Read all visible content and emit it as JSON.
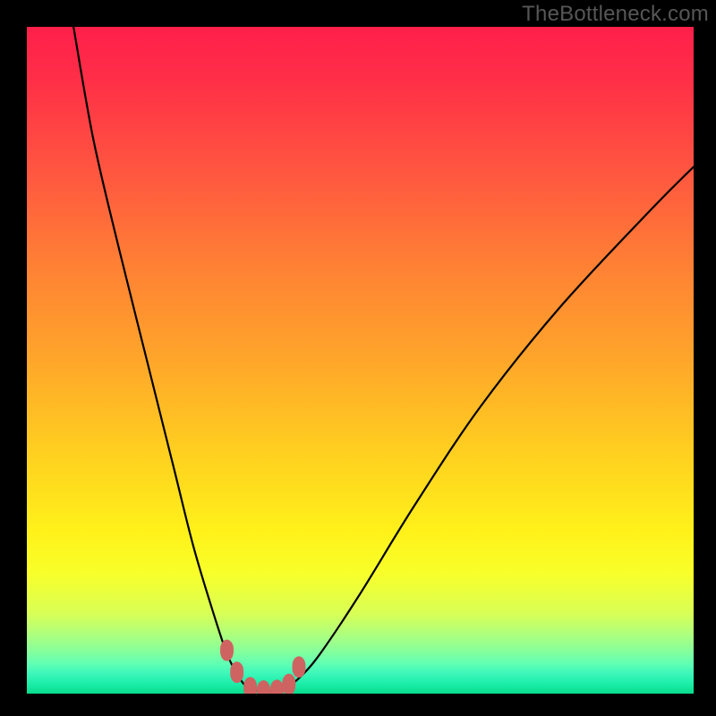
{
  "watermark": "TheBottleneck.com",
  "colors": {
    "frame_bg": "#000000",
    "curve_stroke": "#000000",
    "marker_fill": "#cf6361",
    "gradient_top": "#ff1f4a",
    "gradient_bottom": "#08dd8c"
  },
  "chart_data": {
    "type": "line",
    "title": "",
    "xlabel": "",
    "ylabel": "",
    "xlim": [
      0,
      100
    ],
    "ylim": [
      0,
      100
    ],
    "series": [
      {
        "name": "bottleneck-curve",
        "x": [
          7,
          10,
          14,
          18,
          22,
          25,
          28,
          30,
          31.5,
          33,
          35,
          37,
          39,
          41,
          44,
          50,
          58,
          68,
          80,
          94,
          100
        ],
        "values": [
          100,
          83,
          66,
          50,
          34,
          22,
          12,
          6,
          3,
          1,
          0.4,
          0.4,
          1,
          2.5,
          6,
          15,
          28,
          43,
          58,
          73,
          79
        ]
      }
    ],
    "markers": {
      "name": "trough-markers",
      "x": [
        30,
        31.5,
        33.5,
        35.5,
        37.5,
        39.3,
        40.8
      ],
      "values": [
        6.5,
        3.2,
        0.9,
        0.4,
        0.5,
        1.4,
        4.0
      ]
    }
  }
}
